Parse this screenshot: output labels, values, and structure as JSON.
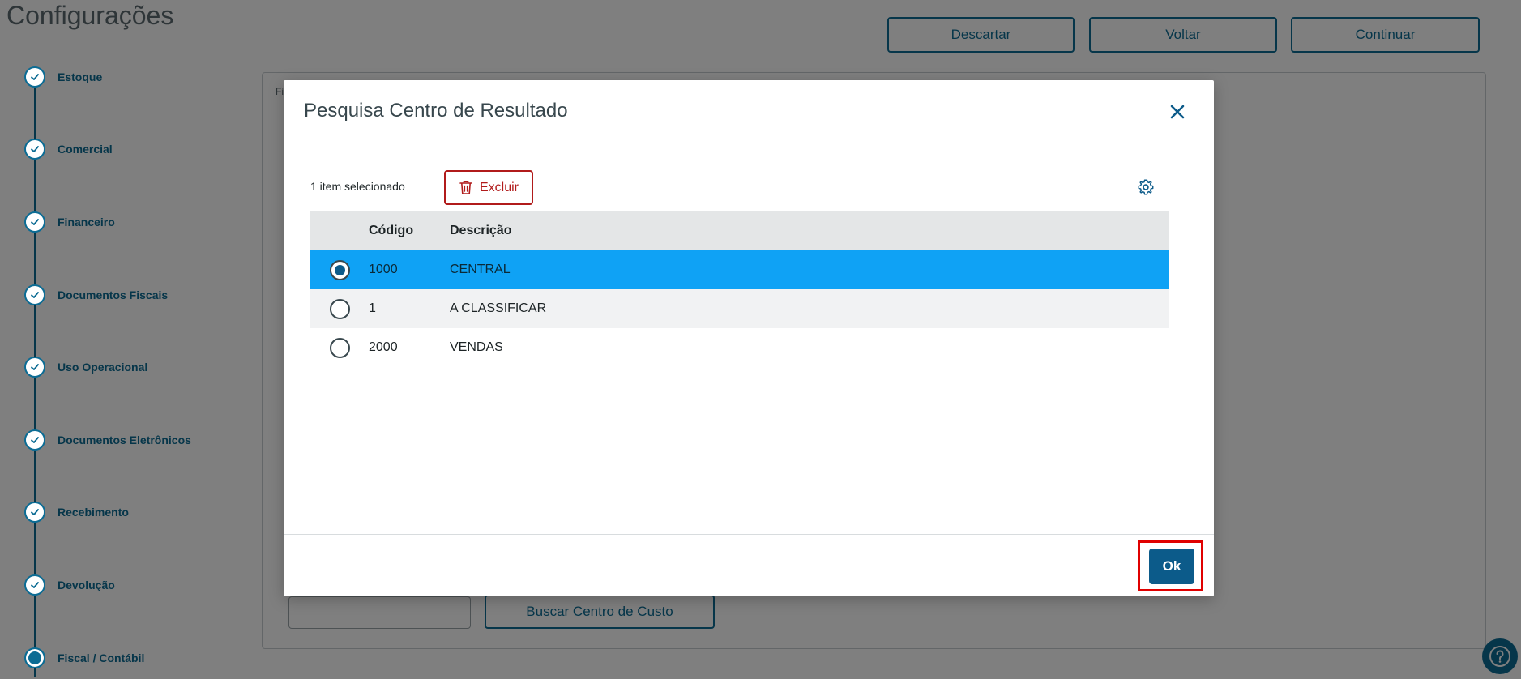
{
  "page": {
    "title": "Configurações",
    "buttons": {
      "discard": "Descartar",
      "back": "Voltar",
      "continue": "Continuar"
    },
    "steps": [
      {
        "label": "Estoque",
        "state": "done"
      },
      {
        "label": "Comercial",
        "state": "done"
      },
      {
        "label": "Financeiro",
        "state": "done"
      },
      {
        "label": "Documentos Fiscais",
        "state": "done"
      },
      {
        "label": "Uso Operacional",
        "state": "done"
      },
      {
        "label": "Documentos Eletrônicos",
        "state": "done"
      },
      {
        "label": "Recebimento",
        "state": "done"
      },
      {
        "label": "Devolução",
        "state": "done"
      },
      {
        "label": "Fiscal / Contábil",
        "state": "current"
      }
    ],
    "panel_fragment": "Fi",
    "search_cost_center": "Buscar Centro de Custo"
  },
  "modal": {
    "title": "Pesquisa Centro de Resultado",
    "selected_count": "1 item selecionado",
    "delete_label": "Excluir",
    "columns": {
      "code": "Código",
      "description": "Descrição"
    },
    "rows": [
      {
        "code": "1000",
        "description": "CENTRAL",
        "selected": true
      },
      {
        "code": "1",
        "description": "A CLASSIFICAR",
        "selected": false
      },
      {
        "code": "2000",
        "description": "VENDAS",
        "selected": false
      }
    ],
    "ok_label": "Ok"
  },
  "colors": {
    "primary": "#0c6c94",
    "ok_button": "#0c5b8a",
    "selected_row": "#0fa2f5",
    "danger": "#b11b1b",
    "highlight": "#e00000"
  },
  "icons": [
    "check-icon",
    "close-icon",
    "trash-icon",
    "gear-icon",
    "help-icon"
  ]
}
